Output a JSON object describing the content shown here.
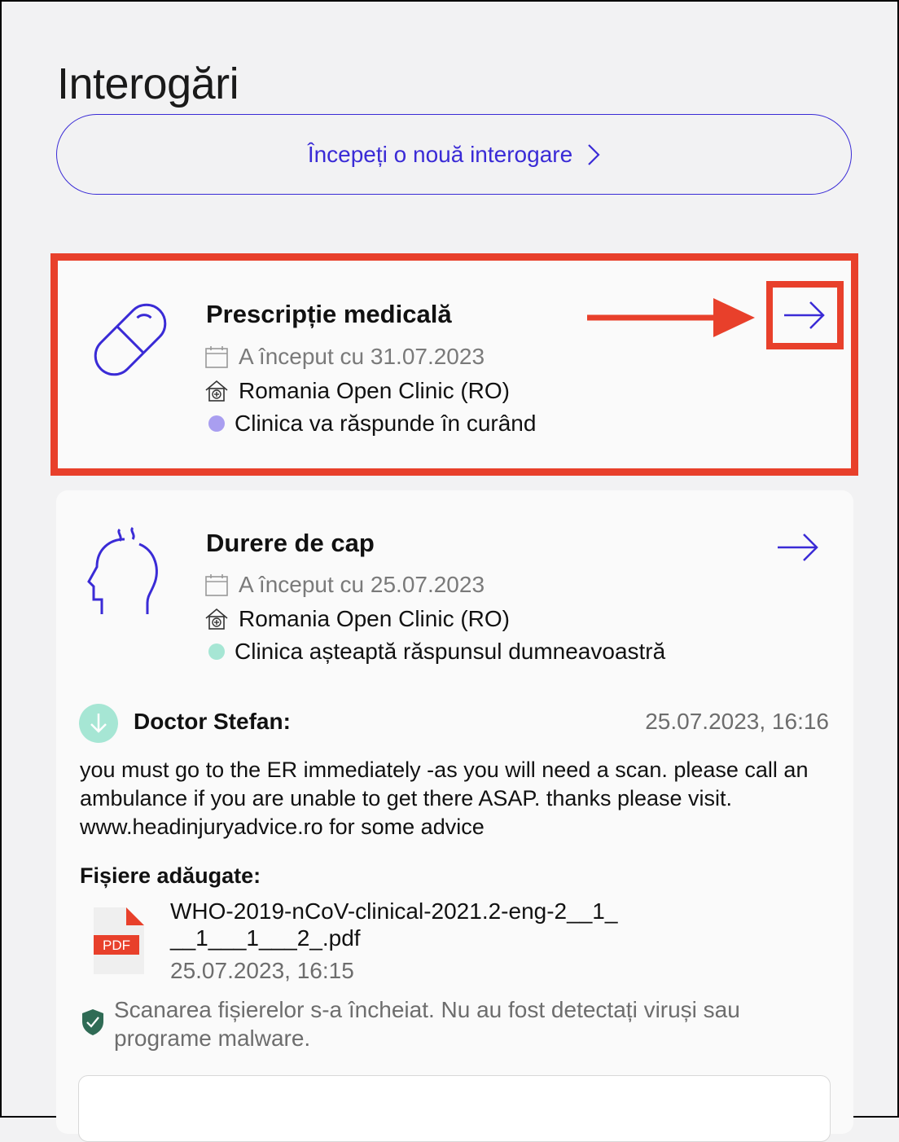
{
  "page": {
    "title": "Interogări"
  },
  "new_button": {
    "label": "Începeți o nouă interogare"
  },
  "cards": [
    {
      "title": "Prescripție medicală",
      "icon": "pill-icon",
      "started": "A început cu 31.07.2023",
      "clinic": "Romania Open Clinic (RO)",
      "status": "Clinica va răspunde în curând",
      "status_color": "#a99ef0"
    },
    {
      "title": "Durere de cap",
      "icon": "head-icon",
      "started": "A început cu 25.07.2023",
      "clinic": "Romania Open Clinic (RO)",
      "status": "Clinica așteaptă răspunsul dumneavoastră",
      "status_color": "#a6e6d4"
    }
  ],
  "message": {
    "author": "Doctor Stefan:",
    "time": "25.07.2023, 16:16",
    "body": "you must go to the ER immediately -as you will need a scan. please call an ambulance if you are unable to get there ASAP. thanks please visit. www.headinjuryadvice.ro for some advice"
  },
  "files": {
    "label": "Fișiere adăugate:",
    "items": [
      {
        "name": "WHO-2019-nCoV-clinical-2021.2-eng-2__1___1___1___2_.pdf",
        "time": "25.07.2023, 16:15",
        "type_label": "PDF"
      }
    ]
  },
  "scan_notice": "Scanarea fișierelor s-a încheiat. Nu au fost detectați viruși sau programe malware.",
  "colors": {
    "accent": "#3a2bd6",
    "highlight": "#e8402b"
  }
}
